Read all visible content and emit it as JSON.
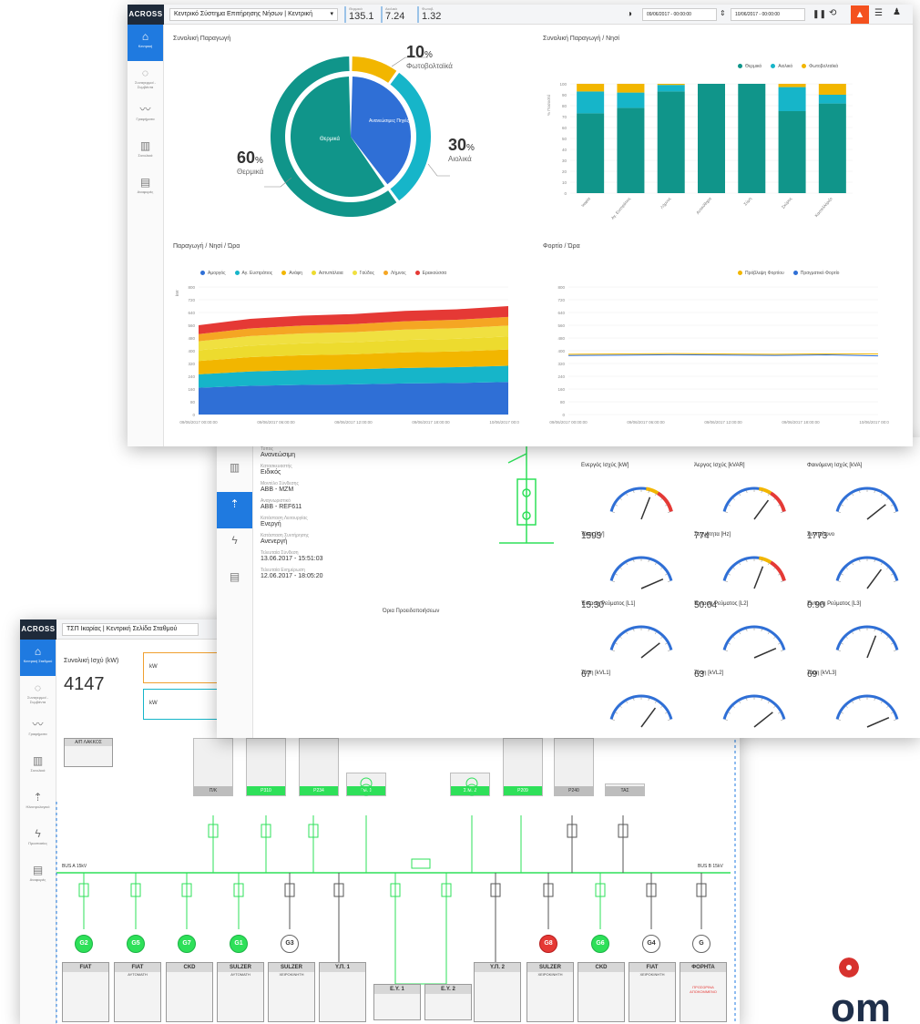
{
  "dash": {
    "logo": "ACROSS",
    "system_select": "Κεντρικό Σύστημα Επιτήρησης Νήσων | Κεντρική",
    "kpis": [
      {
        "label": "Θερμικά",
        "value": "135.1"
      },
      {
        "label": "Αιολικά",
        "value": "7.24"
      },
      {
        "label": "Φωτοβ.",
        "value": "1.32"
      }
    ],
    "date_from": "09/06/2017 - 00:00:00",
    "date_to": "10/06/2017 - 00:00:00",
    "sidebar": [
      {
        "label": "Κεντρική",
        "icon": "home-icon"
      },
      {
        "label": "Συναγερμοί - Συμβάντα",
        "icon": "bulb-icon"
      },
      {
        "label": "Γραφήματα",
        "icon": "trend-icon"
      },
      {
        "label": "Συνολικά",
        "icon": "bars-icon"
      },
      {
        "label": "Αναφορές",
        "icon": "clipboard-icon"
      }
    ],
    "panel_donut_title": "Συνολική Παραγωγή",
    "donut": {
      "inner_label_thermal": "Θερμικά",
      "inner_label_renew": "Ανανεώσιμες Πηγές",
      "pct1": "10",
      "pct1_label": "Φωτοβολταϊκά",
      "pct2": "30",
      "pct2_label": "Αιολικά",
      "pct3": "60",
      "pct3_label": "Θερμικά",
      "pct_sign": "%"
    },
    "panel_bar_title": "Συνολική Παραγωγή / Νησί",
    "panel_area_title": "Παραγωγή / Νησί / Ώρα",
    "panel_load_title": "Φορτίο / Ώρα"
  },
  "chart_data": [
    {
      "type": "pie",
      "categories": [
        "Θερμικά",
        "Αιολικά",
        "Φωτοβολταϊκά"
      ],
      "values": [
        60,
        30,
        10
      ]
    },
    {
      "type": "bar",
      "title": "Συνολική Παραγωγή / Νησί",
      "ylabel": "% Ποσοστό",
      "categories": [
        "Ικαρία",
        "Αγ. Ευστράτιος",
        "Λήμνος",
        "Αντικύθηρα",
        "Σύμη",
        "Σκύρος",
        "Καστελλόριζο"
      ],
      "series": [
        {
          "name": "Θερμικό",
          "values": [
            73,
            78,
            93,
            100,
            100,
            75,
            82
          ]
        },
        {
          "name": "Αιολικό",
          "values": [
            20,
            14,
            6,
            0,
            0,
            22,
            8
          ]
        },
        {
          "name": "Φωτοβολταϊκά",
          "values": [
            7,
            8,
            1,
            0,
            0,
            3,
            10
          ]
        }
      ],
      "yticks": [
        "0",
        "10",
        "20",
        "30",
        "40",
        "50",
        "60",
        "70",
        "80",
        "90",
        "100"
      ],
      "legend": "top-right"
    },
    {
      "type": "area",
      "title": "Παραγωγή / Νησί / Ώρα",
      "ylabel": "kW",
      "ylim": [
        0,
        800
      ],
      "yticks": [
        "0",
        "80",
        "160",
        "240",
        "320",
        "400",
        "480",
        "560",
        "640",
        "720",
        "800"
      ],
      "xticks": [
        "09/06/2017 00:00:00",
        "09/06/2017 06:00:00",
        "09/06/2017 12:00:00",
        "09/06/2017 18:00:00",
        "10/06/2017 00:00:00"
      ],
      "series": [
        {
          "name": "Αμοργός",
          "color": "#2f6fd6"
        },
        {
          "name": "Αγ. Ευστράτιος",
          "color": "#16b5c9"
        },
        {
          "name": "Ανάφη",
          "color": "#f2b600"
        },
        {
          "name": "Αστυπάλαια",
          "color": "#eddb2e"
        },
        {
          "name": "Γαύδος",
          "color": "#f0e040"
        },
        {
          "name": "Λήμνος",
          "color": "#f5a623"
        },
        {
          "name": "Ερεικούσσα",
          "color": "#e53935"
        }
      ],
      "stack_top": [
        560,
        600,
        620,
        630,
        650,
        660,
        680
      ],
      "legend": "top"
    },
    {
      "type": "line",
      "title": "Φορτίο / Ώρα",
      "ylim": [
        0,
        800
      ],
      "yticks": [
        "0",
        "80",
        "160",
        "240",
        "320",
        "400",
        "480",
        "560",
        "640",
        "720",
        "800"
      ],
      "xticks": [
        "09/06/2017 00:00:00",
        "09/06/2017 06:00:00",
        "09/06/2017 12:00:00",
        "09/06/2017 18:00:00",
        "10/06/2017 00:00:00"
      ],
      "series": [
        {
          "name": "Πρόβλεψη Φορτίου",
          "values": [
            378,
            380,
            382,
            380,
            378,
            381,
            380
          ]
        },
        {
          "name": "Πραγματικό Φορτίο",
          "values": [
            370,
            372,
            375,
            373,
            371,
            374,
            368
          ]
        }
      ],
      "legend": "top-right"
    }
  ],
  "detail": {
    "info": [
      {
        "label": "Τύπος",
        "value": "Ανανεώσιμη"
      },
      {
        "label": "Κατασκευαστής",
        "value": "Ειδικός"
      },
      {
        "label": "Μοντέλο Σύνδεσης",
        "value": "ABB - MZM"
      },
      {
        "label": "Αναγνωριστικό",
        "value": "ABB - REF611"
      },
      {
        "label": "Κατάσταση Λειτουργίας",
        "value": "Ενεργή"
      },
      {
        "label": "Κατάσταση Συντήρησης",
        "value": "Ανενεργή"
      },
      {
        "label": "Τελευταία Σύνδεση",
        "value": "13.06.2017 - 15:51:03"
      },
      {
        "label": "Τελευταία Ενημέρωση",
        "value": "12.06.2017 - 18:05:20"
      }
    ],
    "limits_title": "Όρια Προειδοποιήσεων",
    "gauges": [
      {
        "title": "Ενεργός Ισχύς [kW]",
        "value": "1593"
      },
      {
        "title": "Άεργος Ισχύς [kVAR]",
        "value": "774"
      },
      {
        "title": "Φαινόμενη Ισχύς [kVA]",
        "value": "1773"
      },
      {
        "title": "Τάση [kV]",
        "value": "15.30"
      },
      {
        "title": "Συχνότητα [Hz]",
        "value": "50.04"
      },
      {
        "title": "Συνημίτονο",
        "value": "0.90"
      },
      {
        "title": "Ένταση Ρεύματος [L1]",
        "value": "67"
      },
      {
        "title": "Ένταση Ρεύματος [L2]",
        "value": "63"
      },
      {
        "title": "Ένταση Ρεύματος [L3]",
        "value": "69"
      },
      {
        "title": "Τάση [kVL1]",
        "value": "15.45"
      },
      {
        "title": "Τάση [kVL2]",
        "value": "15.45"
      },
      {
        "title": "Τάση [kVL3]",
        "value": "15.30"
      }
    ]
  },
  "scada": {
    "logo": "ACROSS",
    "station_select": "ΤΣΠ Ικαρίας | Κεντρική Σελίδα Σταθμού",
    "total_label": "Συνολική Ισχύ (kW)",
    "total_value": "4147",
    "kw1_unit": "kW",
    "kw1_value": "3843",
    "kw2_unit": "kW",
    "kw2_value": "4147",
    "alarm_box_title": "Α/Π ΛΑΚΚΟΣ",
    "bus_left": "BUS A 15kV",
    "bus_right": "BUS B 15kV",
    "sidebar": [
      {
        "label": "Κεντρική Σταθμού",
        "icon": "home-icon"
      },
      {
        "label": "Συναγερμοί - Συμβάντα",
        "icon": "bulb-icon"
      },
      {
        "label": "Γραφήματα",
        "icon": "trend-icon"
      },
      {
        "label": "Συνολικά",
        "icon": "bars-icon"
      },
      {
        "label": "Ηλεκτρολογικό",
        "icon": "upload-icon"
      },
      {
        "label": "Προστασίες",
        "icon": "bolt-icon"
      },
      {
        "label": "Αναφορές",
        "icon": "clipboard-icon"
      }
    ],
    "feeders": [
      "Π/Κ",
      "P310",
      "P234",
      "ΓΜ. 1",
      "Σ.Μ. 2",
      "P209",
      "P240",
      "ΤΑΣ"
    ],
    "gens": [
      {
        "name": "G2",
        "state": "on"
      },
      {
        "name": "G5",
        "state": "on"
      },
      {
        "name": "G7",
        "state": "on"
      },
      {
        "name": "G1",
        "state": "on"
      },
      {
        "name": "G3",
        "state": "off"
      },
      {
        "name": "G8",
        "state": "fault"
      },
      {
        "name": "G6",
        "state": "on"
      },
      {
        "name": "G4",
        "state": "off"
      },
      {
        "name": "G",
        "state": "off"
      }
    ],
    "cards": [
      {
        "title": "FIAT",
        "sub": ""
      },
      {
        "title": "FIAT",
        "sub": "ΑΥΤΟΜΑΤΗ"
      },
      {
        "title": "CKD",
        "sub": ""
      },
      {
        "title": "SULZER",
        "sub": "ΑΥΤΟΜΑΤΗ"
      },
      {
        "title": "SULZER",
        "sub": "ΧΕΙΡΟΚΙΝΗΤΗ"
      },
      {
        "title": "Υ.Π. 1",
        "sub": ""
      },
      {
        "title": "Ε.Υ. 1",
        "sub": ""
      },
      {
        "title": "Ε.Υ. 2",
        "sub": ""
      },
      {
        "title": "Υ.Π. 2",
        "sub": ""
      },
      {
        "title": "SULZER",
        "sub": "ΧΕΙΡΟΚΙΝΗΤΗ"
      },
      {
        "title": "CKD",
        "sub": ""
      },
      {
        "title": "FIAT",
        "sub": "ΧΕΙΡΟΚΙΝΗΤΗ"
      },
      {
        "title": "ΦΟΡΗΤΑ",
        "sub": ""
      }
    ],
    "portable_note": "ΠΡΟΣΩΡΙΝΑ ΑΠΟΚΟΜΜΕΝΟ"
  },
  "brand_text": "om",
  "colors": {
    "thermal": "#10958a",
    "wind": "#16b5c9",
    "pv": "#f2b600",
    "blue": "#2f6fd6",
    "green": "#2ee059",
    "red": "#e53935"
  }
}
